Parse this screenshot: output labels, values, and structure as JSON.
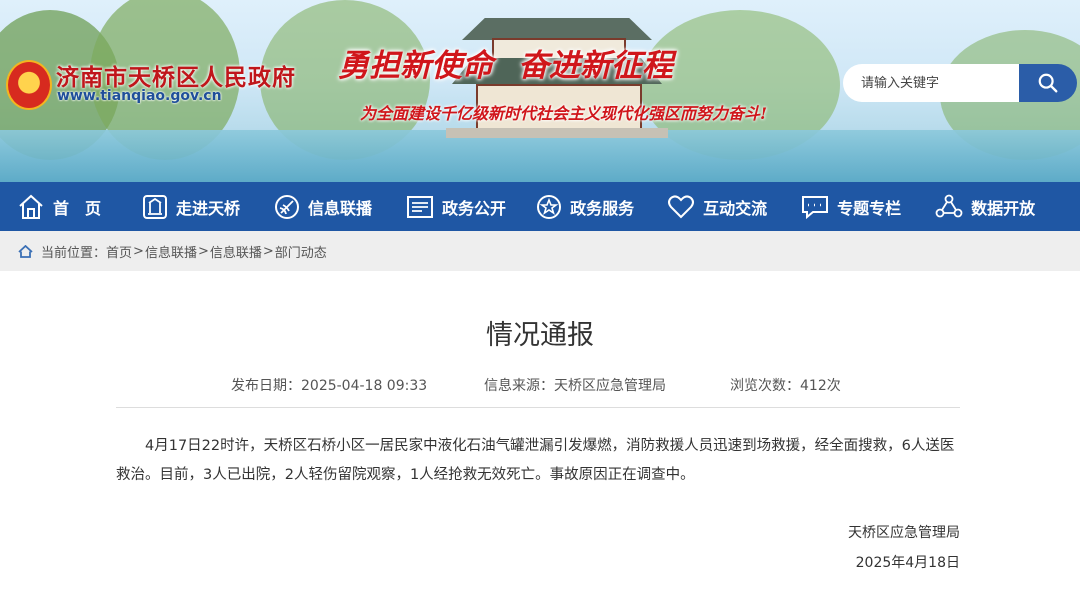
{
  "header": {
    "site_name": "济南市天桥区人民政府",
    "site_url": "www.tianqiao.gov.cn",
    "slogan_part1": "勇担新使命",
    "slogan_part2": "奋进新征程",
    "sub_slogan": "为全面建设千亿级新时代社会主义现代化强区而努力奋斗!",
    "search": {
      "placeholder": "请输入关键字",
      "icon": "search-icon"
    }
  },
  "nav": {
    "items": [
      {
        "label": "首　页",
        "icon": "home-icon"
      },
      {
        "label": "走进天桥",
        "icon": "building-icon"
      },
      {
        "label": "信息联播",
        "icon": "broadcast-icon"
      },
      {
        "label": "政务公开",
        "icon": "document-icon"
      },
      {
        "label": "政务服务",
        "icon": "star-icon"
      },
      {
        "label": "互动交流",
        "icon": "heart-icon"
      },
      {
        "label": "专题专栏",
        "icon": "chat-icon"
      },
      {
        "label": "数据开放",
        "icon": "network-icon"
      }
    ],
    "colors": {
      "background": "#1f57a4",
      "text": "#ffffff"
    }
  },
  "breadcrumb": {
    "prefix": "当前位置：",
    "items": [
      "首页",
      "信息联播",
      "信息联播",
      "部门动态"
    ],
    "separator": ">"
  },
  "article": {
    "title": "情况通报",
    "publish_date": "发布日期：2025-04-18 09:33",
    "source": "信息来源：天桥区应急管理局",
    "views": "浏览次数：412次",
    "body": "4月17日22时许，天桥区石桥小区一居民家中液化石油气罐泄漏引发爆燃，消防救援人员迅速到场救援，经全面搜救，6人送医救治。目前，3人已出院，2人轻伤留院观察，1人经抢救无效死亡。事故原因正在调查中。",
    "signature": "天桥区应急管理局",
    "signature_date": "2025年4月18日"
  }
}
